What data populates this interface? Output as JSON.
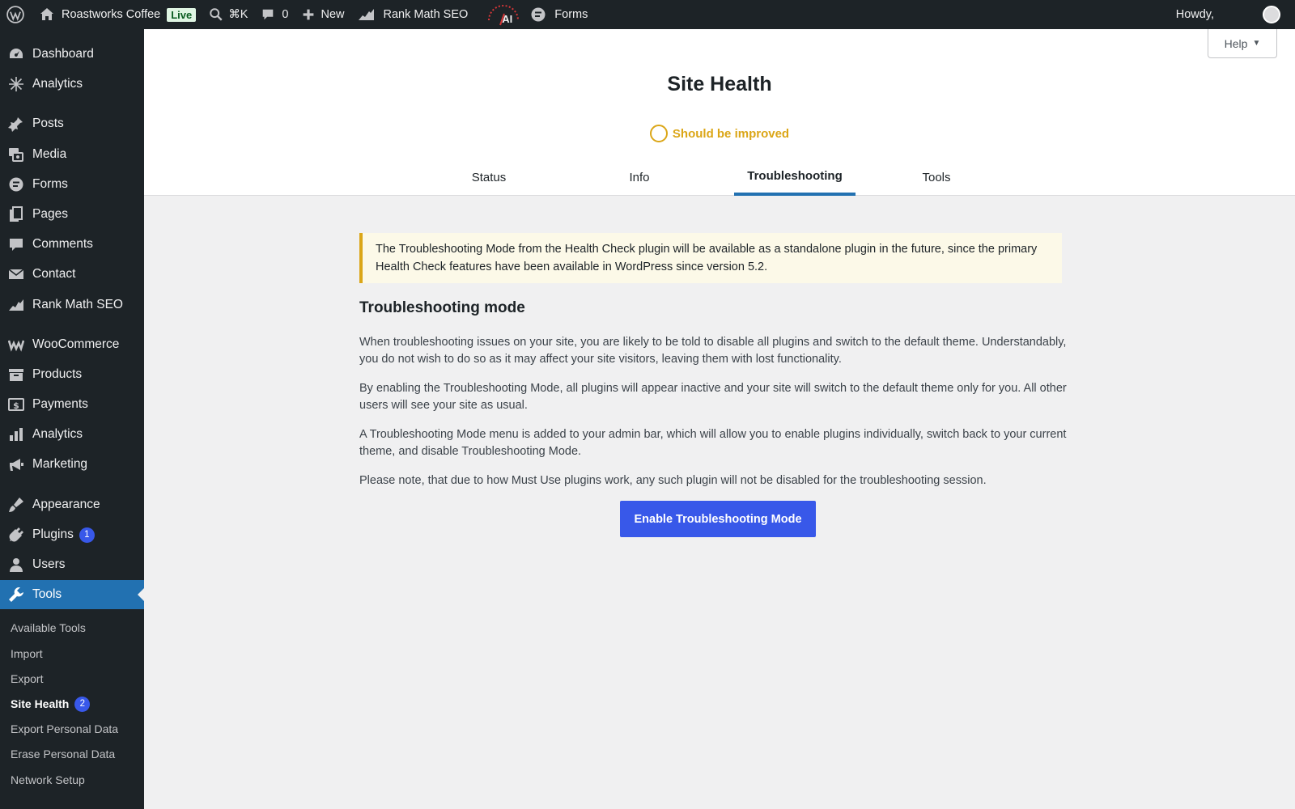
{
  "adminbar": {
    "site_name": "Roastworks Coffee",
    "live_badge": "Live",
    "search_shortcut": "⌘K",
    "comments_count": "0",
    "new_label": "New",
    "rankmath_label": "Rank Math SEO",
    "ai_label": "AI",
    "forms_label": "Forms",
    "howdy": "Howdy,"
  },
  "sidebar": {
    "items": [
      {
        "label": "Dashboard",
        "icon": "dashboard-icon"
      },
      {
        "label": "Analytics",
        "icon": "analytics-icon"
      },
      {
        "label": "Posts",
        "icon": "pin-icon"
      },
      {
        "label": "Media",
        "icon": "media-icon"
      },
      {
        "label": "Forms",
        "icon": "forms-icon"
      },
      {
        "label": "Pages",
        "icon": "pages-icon"
      },
      {
        "label": "Comments",
        "icon": "comment-icon"
      },
      {
        "label": "Contact",
        "icon": "mail-icon"
      },
      {
        "label": "Rank Math SEO",
        "icon": "rankmath-icon"
      },
      {
        "label": "WooCommerce",
        "icon": "woo-icon"
      },
      {
        "label": "Products",
        "icon": "archive-icon"
      },
      {
        "label": "Payments",
        "icon": "payment-icon"
      },
      {
        "label": "Analytics",
        "icon": "bar-chart-icon"
      },
      {
        "label": "Marketing",
        "icon": "megaphone-icon"
      },
      {
        "label": "Appearance",
        "icon": "brush-icon"
      },
      {
        "label": "Plugins",
        "icon": "plug-icon",
        "badge": "1"
      },
      {
        "label": "Users",
        "icon": "user-icon"
      },
      {
        "label": "Tools",
        "icon": "wrench-icon"
      }
    ],
    "submenu": [
      {
        "label": "Available Tools"
      },
      {
        "label": "Import"
      },
      {
        "label": "Export"
      },
      {
        "label": "Site Health",
        "badge": "2"
      },
      {
        "label": "Export Personal Data"
      },
      {
        "label": "Erase Personal Data"
      },
      {
        "label": "Network Setup"
      }
    ]
  },
  "header": {
    "help_label": "Help",
    "title": "Site Health",
    "status": "Should be improved",
    "tabs": [
      {
        "label": "Status"
      },
      {
        "label": "Info"
      },
      {
        "label": "Troubleshooting"
      },
      {
        "label": "Tools"
      }
    ]
  },
  "main": {
    "notice": "The Troubleshooting Mode from the Health Check plugin will be available as a standalone plugin in the future, since the primary Health Check features have been available in WordPress since version 5.2.",
    "section_title": "Troubleshooting mode",
    "paragraphs": [
      "When troubleshooting issues on your site, you are likely to be told to disable all plugins and switch to the default theme. Understandably, you do not wish to do so as it may affect your site visitors, leaving them with lost functionality.",
      "By enabling the Troubleshooting Mode, all plugins will appear inactive and your site will switch to the default theme only for you. All other users will see your site as usual.",
      "A Troubleshooting Mode menu is added to your admin bar, which will allow you to enable plugins individually, switch back to your current theme, and disable Troubleshooting Mode.",
      "Please note, that due to how Must Use plugins work, any such plugin will not be disabled for the troubleshooting session."
    ],
    "button_label": "Enable Troubleshooting Mode"
  },
  "colors": {
    "adminbar_bg": "#1d2327",
    "active_menu": "#2271b1",
    "button": "#3858e9",
    "warning": "#dba617",
    "notice_bg": "#fcf9e8"
  }
}
